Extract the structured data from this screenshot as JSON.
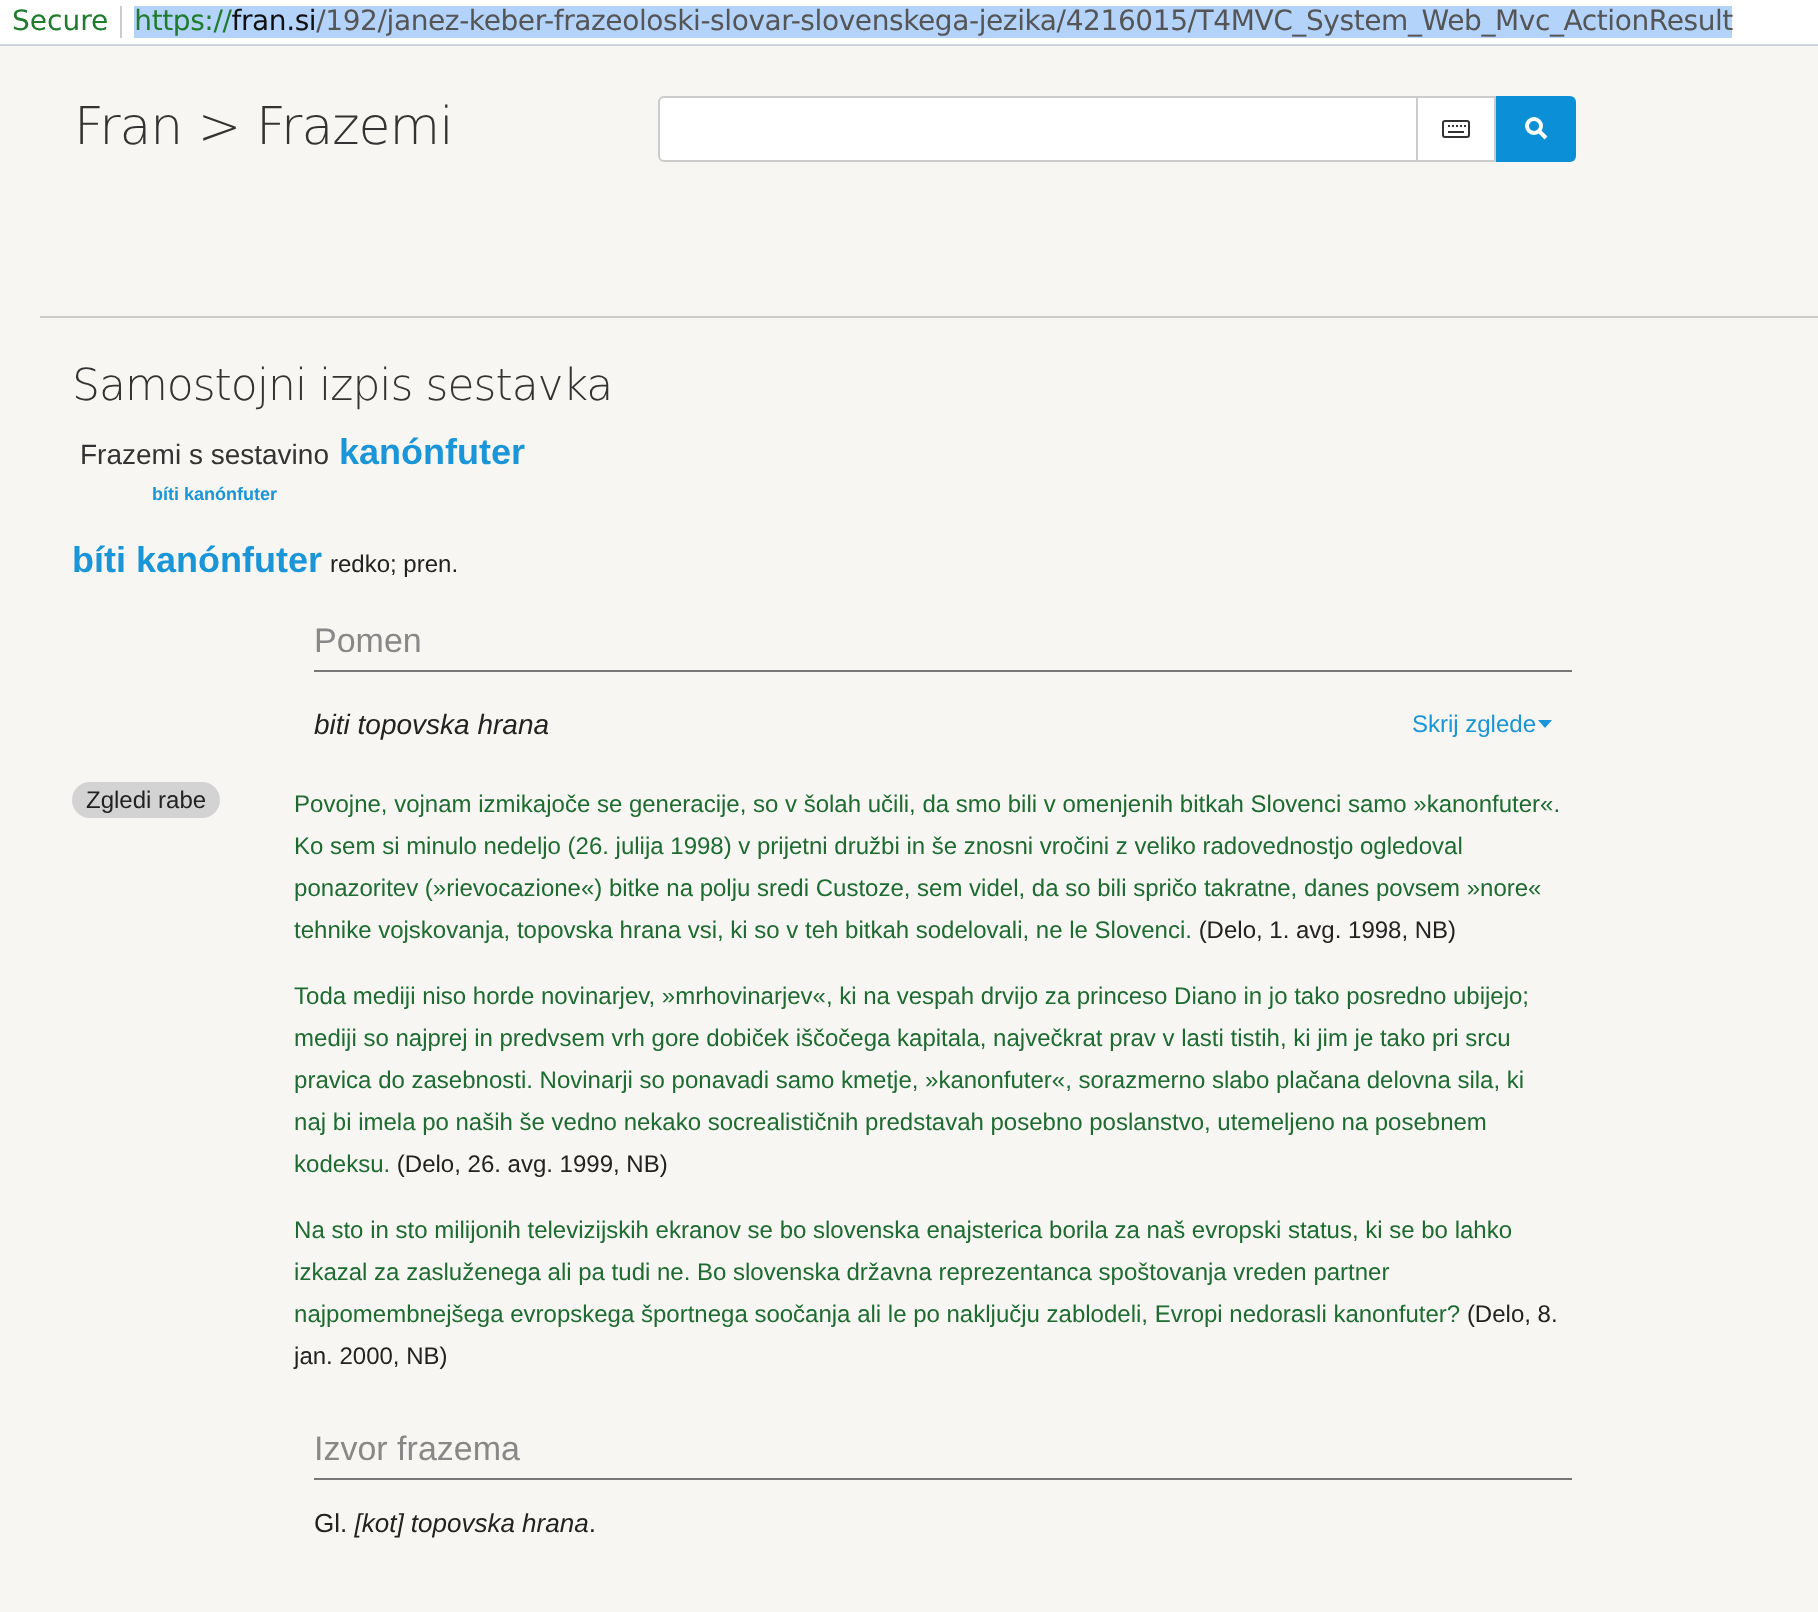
{
  "address_bar": {
    "security": "Secure",
    "url_scheme": "https://",
    "url_host": "fran.si",
    "url_path": "/192/janez-keber-frazeoloski-slovar-slovenskega-jezika/4216015/T4MVC_System_Web_Mvc_ActionResult"
  },
  "header": {
    "title": "Fran > Frazemi"
  },
  "page_title": "Samostojni izpis sestavka",
  "component": {
    "label": "Frazemi s sestavino",
    "word": "kanónfuter",
    "phrases": [
      "bíti kanónfuter"
    ]
  },
  "entry": {
    "headword": "bíti kanónfuter",
    "qualifiers": "redko; pren."
  },
  "meaning": {
    "heading": "Pomen",
    "definition": "biti topovska hrana",
    "toggle": "Skrij zglede",
    "examples_label": "Zgledi rabe",
    "examples": [
      {
        "text": "Povojne, vojnam izmikajoče se generacije, so v šolah učili, da smo bili v omenjenih bitkah Slovenci samo »kanonfuter«. Ko sem si minulo nedeljo (26. julija 1998) v prijetni družbi in še znosni vročini z veliko radovednostjo ogledoval ponazoritev (»rievocazione«) bitke na polju sredi Custoze, sem videl, da so bili spričo takratne, danes povsem »nore« tehnike vojskovanja, topovska hrana vsi, ki so v teh bitkah sodelovali, ne le Slovenci.",
        "source": "(Delo, 1. avg. 1998, NB)"
      },
      {
        "text": "Toda mediji niso horde novinarjev, »mrhovinarjev«, ki na vespah drvijo za princeso Diano in jo tako posredno ubijejo; mediji so najprej in predvsem vrh gore dobiček iščočega kapitala, največkrat prav v lasti tistih, ki jim je tako pri srcu pravica do zasebnosti. Novinarji so ponavadi samo kmetje, »kanonfuter«, sorazmerno slabo plačana delovna sila, ki naj bi imela po naših še vedno nekako socrealističnih predstavah posebno poslanstvo, utemeljeno na posebnem kodeksu.",
        "source": "(Delo, 26. avg. 1999, NB)"
      },
      {
        "text": "Na sto in sto milijonih televizijskih ekranov se bo slovenska enajsterica borila za naš evropski status, ki se bo lahko izkazal za zasluženega ali pa tudi ne. Bo slovenska državna reprezentanca spoštovanja vreden partner najpomembnejšega evropskega športnega soočanja ali le po naključju zablodeli, Evropi nedorasli kanonfuter?",
        "source": "(Delo, 8. jan. 2000, NB)"
      }
    ]
  },
  "origin": {
    "heading": "Izvor frazema",
    "text": "Gl. *[kot] topovska hrana*."
  }
}
